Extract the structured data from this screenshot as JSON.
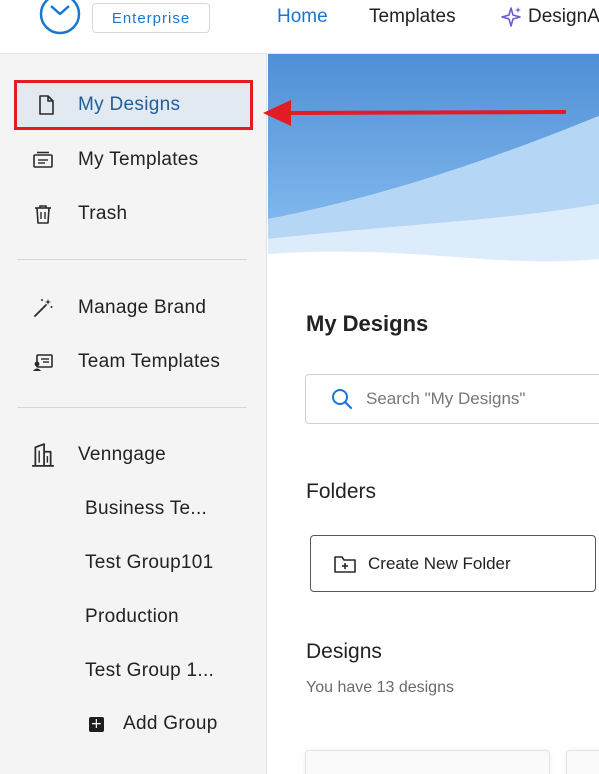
{
  "header": {
    "logo_icon": "venngage-logo-icon",
    "badge": "Enterprise",
    "nav": {
      "home": "Home",
      "templates": "Templates",
      "design_ai": "DesignA",
      "design_ai_icon": "sparkle-icon"
    }
  },
  "sidebar": {
    "primary": [
      {
        "label": "My Designs",
        "icon": "document-icon",
        "active": true
      },
      {
        "label": "My Templates",
        "icon": "templates-icon"
      },
      {
        "label": "Trash",
        "icon": "trash-icon"
      }
    ],
    "brand": [
      {
        "label": "Manage Brand",
        "icon": "magic-wand-icon"
      },
      {
        "label": "Team Templates",
        "icon": "team-templates-icon"
      }
    ],
    "workspace": {
      "label": "Venngage",
      "icon": "building-icon",
      "groups": [
        "Business Te...",
        "Test Group101",
        "Production",
        "Test Group 1..."
      ],
      "add_group": "Add Group",
      "add_group_icon": "plus-square-icon"
    }
  },
  "main": {
    "title": "My Designs",
    "search": {
      "placeholder": "Search \"My Designs\"",
      "value": ""
    },
    "folders": {
      "title": "Folders",
      "create_label": "Create New Folder"
    },
    "designs": {
      "title": "Designs",
      "count_text": "You have 13 designs"
    }
  },
  "colors": {
    "accent": "#1976d2",
    "active_text": "#1f5f99",
    "active_bg": "#e3e9f1",
    "annotation_red": "#e31b23",
    "sidebar_bg": "#f4f4f4"
  }
}
